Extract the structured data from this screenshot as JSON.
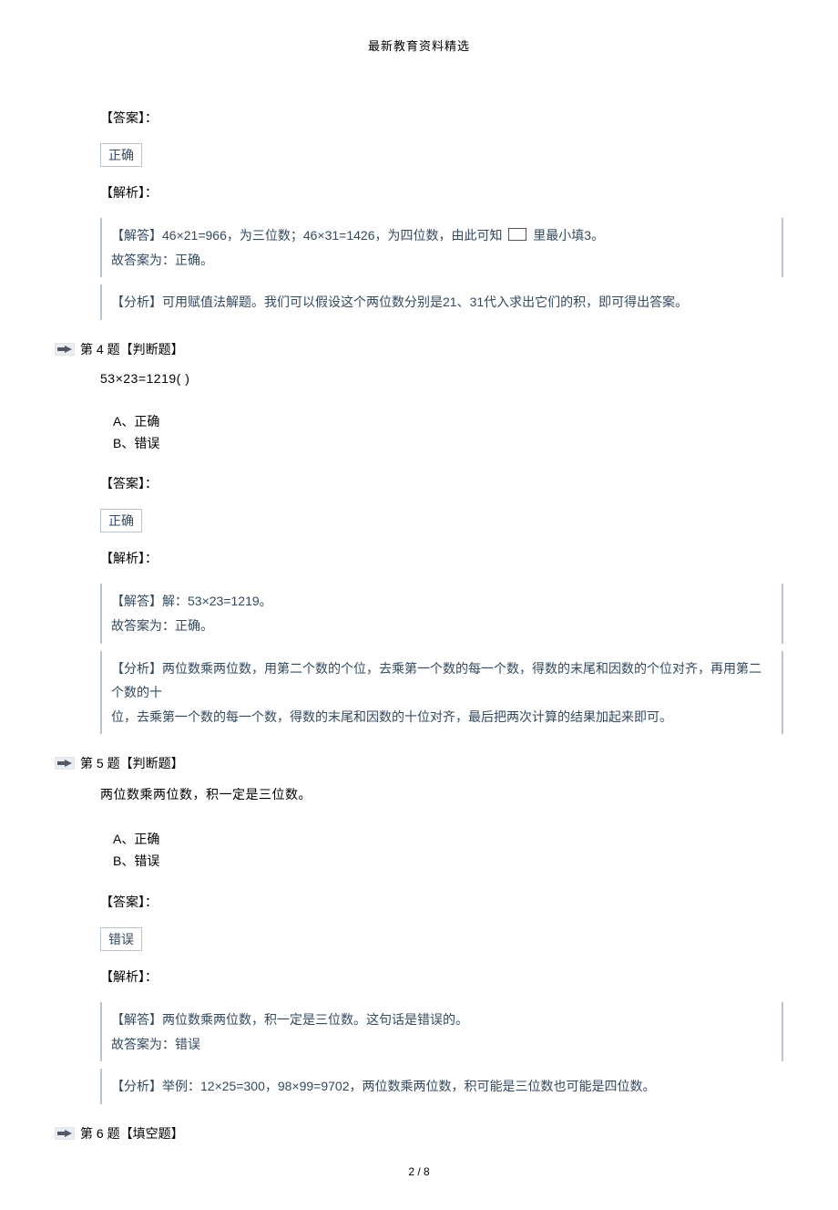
{
  "header": "最新教育资料精选",
  "q3": {
    "answer_label": "【答案】：",
    "answer_value": "正确",
    "analysis_label": "【解析】：",
    "explain_line1_a": "【解答】46×21=966，为三位数；46×31=1426，为四位数，由此可知 ",
    "explain_line1_b": " 里最小填3。",
    "explain_line2": "故答案为：正确。",
    "analysis_line": "【分析】可用赋值法解题。我们可以假设这个两位数分别是21、31代入求出它们的积，即可得出答案。"
  },
  "q4": {
    "title": "第 4 题【判断题】",
    "question": "53×23=1219(     )",
    "opt_a_letter": "A、",
    "opt_a_text": "正确",
    "opt_b_letter": "B、",
    "opt_b_text": "错误",
    "answer_label": "【答案】：",
    "answer_value": "正确",
    "analysis_label": "【解析】：",
    "explain_line1": "【解答】解：53×23=1219。",
    "explain_line2": "故答案为：正确。",
    "analysis_line1": "【分析】两位数乘两位数，用第二个数的个位，去乘第一个数的每一个数，得数的末尾和因数的个位对齐，再用第二个数的十",
    "analysis_line2": "位，去乘第一个数的每一个数，得数的末尾和因数的十位对齐，最后把两次计算的结果加起来即可。"
  },
  "q5": {
    "title": "第 5 题【判断题】",
    "question": "两位数乘两位数，积一定是三位数。",
    "opt_a_letter": "A、",
    "opt_a_text": "正确",
    "opt_b_letter": "B、",
    "opt_b_text": "错误",
    "answer_label": "【答案】：",
    "answer_value": "错误",
    "analysis_label": "【解析】：",
    "explain_line1": "【解答】两位数乘两位数，积一定是三位数。这句话是错误的。",
    "explain_line2": "故答案为：错误",
    "analysis_line": "【分析】举例：12×25=300，98×99=9702，两位数乘两位数，积可能是三位数也可能是四位数。"
  },
  "q6": {
    "title": "第 6 题【填空题】"
  },
  "footer": "2 / 8"
}
